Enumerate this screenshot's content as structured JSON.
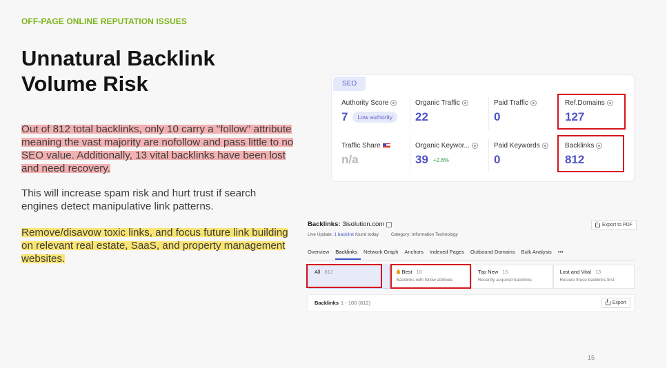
{
  "slide": {
    "eyebrow": "OFF-PAGE ONLINE REPUTATION ISSUES",
    "title": "Unnatural Backlink Volume Risk",
    "paragraph1": "Out of 812 total backlinks, only 10 carry a \"follow\" attribute meaning the vast majority are nofollow and pass little to no SEO value. Additionally, 13 vital backlinks have been lost and need recovery.",
    "paragraph2": "This will increase spam risk and hurt trust if search engines detect manipulative link patterns.",
    "paragraph3": "Remove/disavow toxic links, and focus future link building on relevant real estate, SaaS, and property management websites.",
    "page_number": "15"
  },
  "seo": {
    "tag": "SEO",
    "authority_score": {
      "label": "Authority Score",
      "value": "7",
      "badge": "Low authority"
    },
    "organic_traffic": {
      "label": "Organic Traffic",
      "value": "22"
    },
    "paid_traffic": {
      "label": "Paid Traffic",
      "value": "0"
    },
    "ref_domains": {
      "label": "Ref.Domains",
      "value": "127"
    },
    "traffic_share": {
      "label": "Traffic Share",
      "value": "n/a"
    },
    "organic_keywords": {
      "label": "Organic Keywor...",
      "value": "39",
      "growth": "+2.6%"
    },
    "paid_keywords": {
      "label": "Paid Keywords",
      "value": "0"
    },
    "backlinks": {
      "label": "Backlinks",
      "value": "812"
    }
  },
  "backlinks_panel": {
    "title_prefix": "Backlinks:",
    "domain": "3isolution.com",
    "live_update_prefix": "Live Update:",
    "live_update_link": "1 backlink",
    "live_update_suffix": "found today",
    "category": "Category: Information Technology",
    "export_pdf": "Export to PDF",
    "tabs": [
      "Overview",
      "Backlinks",
      "Network Graph",
      "Anchors",
      "Indexed Pages",
      "Outbound Domains",
      "Bulk Analysis",
      "•••"
    ],
    "filters": [
      {
        "label": "All",
        "count": "812",
        "sub": ""
      },
      {
        "label": "Best",
        "count": "10",
        "sub": "Backlinks with follow attribute"
      },
      {
        "label": "Top New",
        "count": "15",
        "sub": "Recently acquired backlinks"
      },
      {
        "label": "Lost and Vital",
        "count": "13",
        "sub": "Restore these backlinks first"
      }
    ],
    "table_title": "Backlinks",
    "table_range": "1 - 100 (812)",
    "export": "Export"
  },
  "colors": {
    "accent_green": "#7cb518",
    "metric_blue": "#4f55c4",
    "highlight_box": "#d6141b"
  }
}
